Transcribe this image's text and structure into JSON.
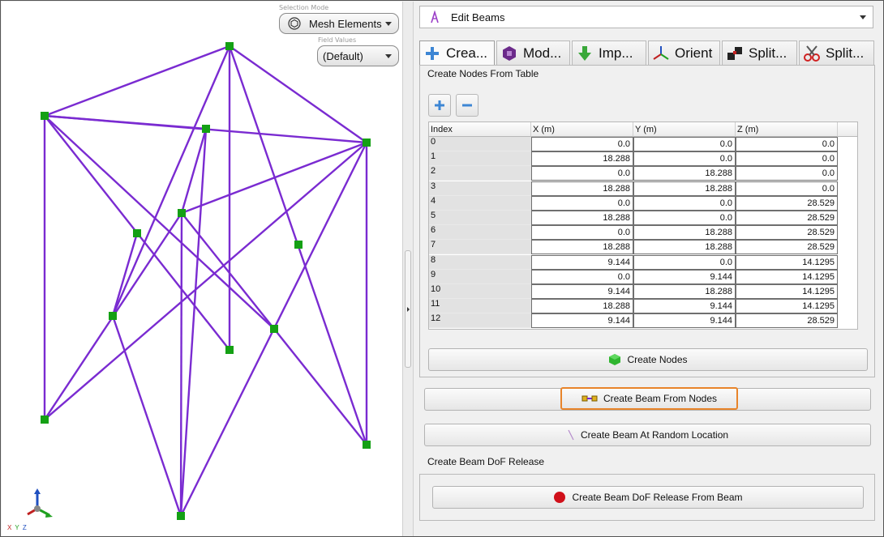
{
  "viewport": {
    "selection_mode_label": "Selection Mode",
    "selection_mode_value": "Mesh Elements",
    "field_values_label": "Field Values",
    "field_values_value": "(Default)",
    "axis_labels": "X Y Z",
    "colors": {
      "beam": "#7a2bd1",
      "node": "#14a014"
    }
  },
  "panel": {
    "edit_dropdown": "Edit Beams",
    "tabs": [
      {
        "label": "Crea...",
        "icon": "plus-icon"
      },
      {
        "label": "Mod...",
        "icon": "modify-icon"
      },
      {
        "label": "Imp...",
        "icon": "import-icon"
      },
      {
        "label": "Orient",
        "icon": "orient-axes-icon"
      },
      {
        "label": "Split...",
        "icon": "split-icon"
      },
      {
        "label": "Split...",
        "icon": "scissors-icon"
      }
    ],
    "create_nodes_title": "Create Nodes From Table",
    "table": {
      "headers": [
        "Index",
        "X (m)",
        "Y (m)",
        "Z (m)"
      ],
      "rows": [
        [
          "0",
          "0.0",
          "0.0",
          "0.0"
        ],
        [
          "1",
          "18.288",
          "0.0",
          "0.0"
        ],
        [
          "2",
          "0.0",
          "18.288",
          "0.0"
        ],
        [
          "3",
          "18.288",
          "18.288",
          "0.0"
        ],
        [
          "4",
          "0.0",
          "0.0",
          "28.529"
        ],
        [
          "5",
          "18.288",
          "0.0",
          "28.529"
        ],
        [
          "6",
          "0.0",
          "18.288",
          "28.529"
        ],
        [
          "7",
          "18.288",
          "18.288",
          "28.529"
        ],
        [
          "8",
          "9.144",
          "0.0",
          "14.1295"
        ],
        [
          "9",
          "0.0",
          "9.144",
          "14.1295"
        ],
        [
          "10",
          "9.144",
          "18.288",
          "14.1295"
        ],
        [
          "11",
          "18.288",
          "9.144",
          "14.1295"
        ],
        [
          "12",
          "9.144",
          "9.144",
          "28.529"
        ]
      ]
    },
    "create_nodes_button": "Create Nodes",
    "create_beam_from_nodes_button": "Create Beam From Nodes",
    "create_beam_random_button": "Create Beam At Random Location",
    "dof_release_title": "Create Beam DoF Release",
    "dof_release_button": "Create Beam DoF Release From Beam",
    "colors": {
      "focus_border": "#e8842a",
      "dof_dot": "#d0101a",
      "create_nodes_cube": "#2fb52f"
    }
  }
}
